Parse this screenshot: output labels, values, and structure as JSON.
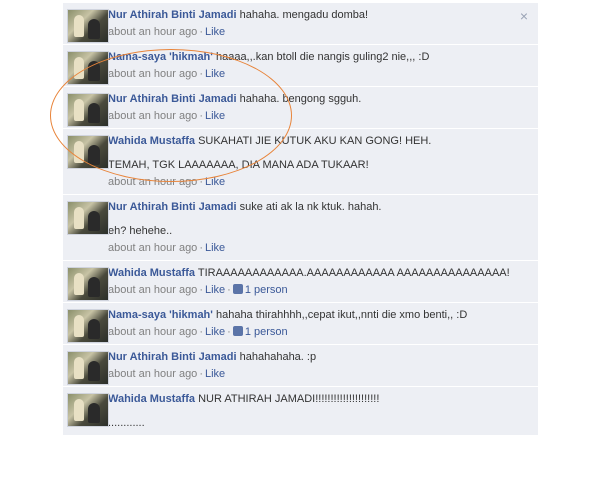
{
  "close_icon": "×",
  "comments": [
    {
      "author": "Nur Athirah Binti Jamadi",
      "lines": [
        "hahaha. mengadu domba!"
      ],
      "time": "about an hour ago",
      "like": "Like",
      "likes": ""
    },
    {
      "author": "Nama-saya 'hikmah'",
      "lines": [
        "haaaa,,.kan btoll die nangis guling2 nie,,, :D"
      ],
      "time": "about an hour ago",
      "like": "Like",
      "likes": ""
    },
    {
      "author": "Nur Athirah Binti Jamadi",
      "lines": [
        "hahaha. bengong sgguh."
      ],
      "time": "about an hour ago",
      "like": "Like",
      "likes": ""
    },
    {
      "author": "Wahida Mustaffa",
      "lines": [
        "SUKAHATI JIE KUTUK AKU KAN GONG! HEH.",
        "TEMAH, TGK LAAAAAAA, DIA MANA ADA TUKAAR!"
      ],
      "time": "about an hour ago",
      "like": "Like",
      "likes": ""
    },
    {
      "author": "Nur Athirah Binti Jamadi",
      "lines": [
        "suke ati ak la nk ktuk. hahah.",
        "eh? hehehe.."
      ],
      "time": "about an hour ago",
      "like": "Like",
      "likes": ""
    },
    {
      "author": "Wahida Mustaffa",
      "lines": [
        "TIRAAAAAAAAAAAA.AAAAAAAAAAAA AAAAAAAAAAAAAAA!"
      ],
      "time": "about an hour ago",
      "like": "Like",
      "likes": "1 person"
    },
    {
      "author": "Nama-saya 'hikmah'",
      "lines": [
        "hahaha thirahhhh,,cepat ikut,,nnti die xmo benti,, :D"
      ],
      "time": "about an hour ago",
      "like": "Like",
      "likes": "1 person"
    },
    {
      "author": "Nur Athirah Binti Jamadi",
      "lines": [
        "hahahahaha. :p"
      ],
      "time": "about an hour ago",
      "like": "Like",
      "likes": ""
    },
    {
      "author": "Wahida Mustaffa",
      "lines": [
        "NUR ATHIRAH JAMADI!!!!!!!!!!!!!!!!!!!!!",
        "............"
      ],
      "time": "",
      "like": "",
      "likes": ""
    }
  ]
}
